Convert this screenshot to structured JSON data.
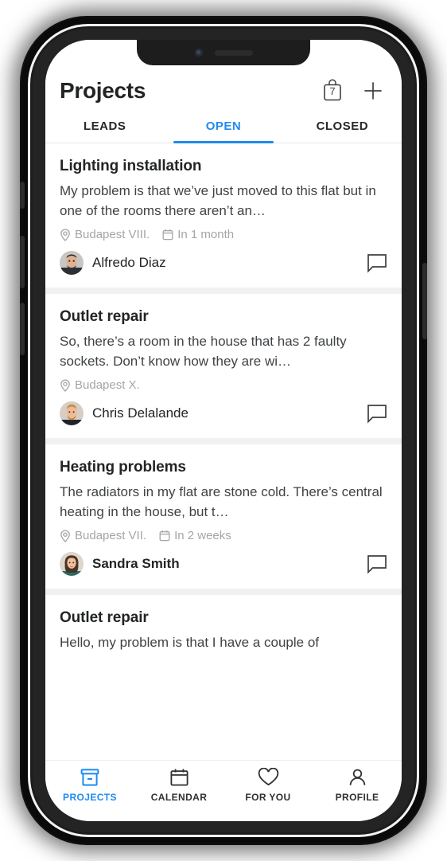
{
  "header": {
    "title": "Projects",
    "bag_badge": "7",
    "bag_icon": "shopping-bag-icon",
    "add_icon": "plus-icon"
  },
  "tabs": [
    {
      "label": "LEADS",
      "active": false
    },
    {
      "label": "OPEN",
      "active": true
    },
    {
      "label": "CLOSED",
      "active": false
    }
  ],
  "accent_color": "#1f8bf0",
  "projects": [
    {
      "title": "Lighting installation",
      "description": "My problem is that we’ve just moved to this flat but in one of the rooms there aren’t an…",
      "location": "Budapest VIII.",
      "date": "In 1 month",
      "author": "Alfredo Diaz",
      "unread": false
    },
    {
      "title": "Outlet repair",
      "description": "So, there’s a room in the house that has 2 faulty sockets. Don’t know how they are wi…",
      "location": "Budapest X.",
      "date": "",
      "author": "Chris Delalande",
      "unread": false
    },
    {
      "title": "Heating problems",
      "description": "The radiators in my flat are stone cold. There’s central heating in the house, but t…",
      "location": "Budapest VII.",
      "date": "In 2 weeks",
      "author": "Sandra Smith",
      "unread": true
    },
    {
      "title": "Outlet repair",
      "description": "Hello, my problem is that I have a couple of",
      "location": "",
      "date": "",
      "author": "",
      "unread": false
    }
  ],
  "bottom_nav": [
    {
      "label": "PROJECTS",
      "icon": "archive-box-icon",
      "active": true
    },
    {
      "label": "CALENDAR",
      "icon": "calendar-icon",
      "active": false
    },
    {
      "label": "FOR YOU",
      "icon": "heart-icon",
      "active": false
    },
    {
      "label": "PROFILE",
      "icon": "person-icon",
      "active": false
    }
  ]
}
